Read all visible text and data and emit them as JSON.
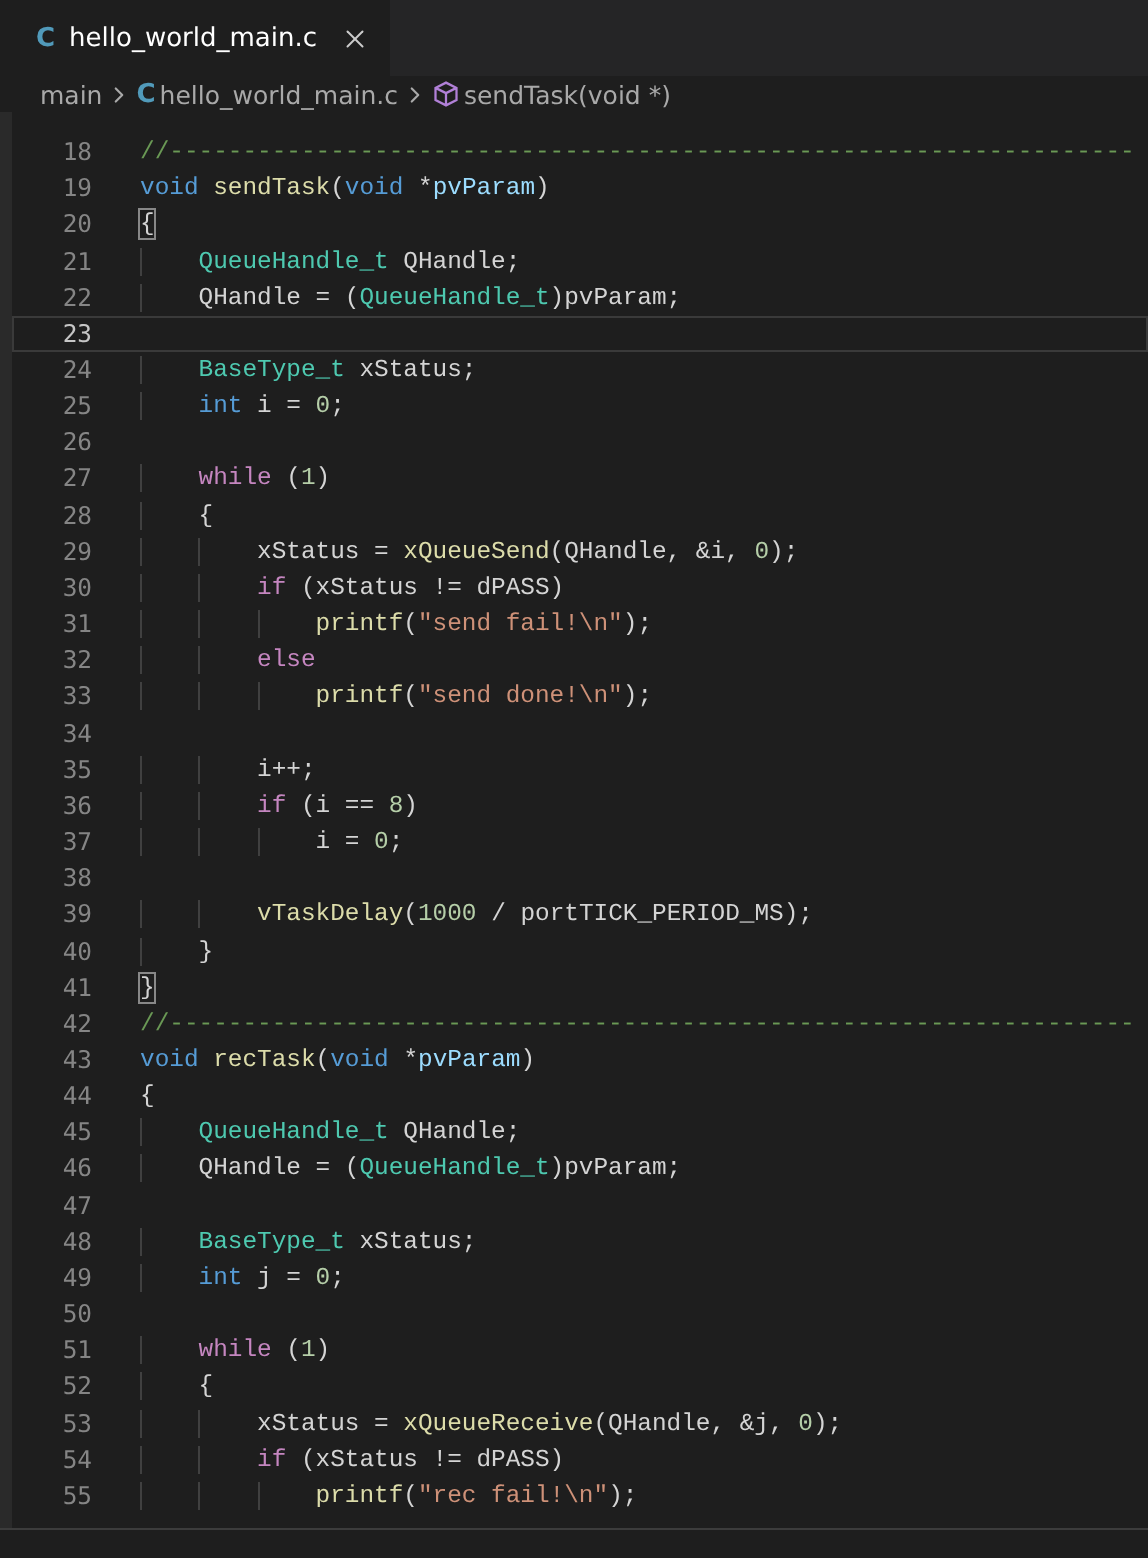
{
  "tabs": [
    {
      "label": "hello_world_main.c",
      "icon": "C",
      "selected": true
    }
  ],
  "breadcrumb": [
    {
      "kind": "folder",
      "label": "main"
    },
    {
      "kind": "file",
      "icon": "C",
      "label": "hello_world_main.c"
    },
    {
      "kind": "symbol",
      "label": "sendTask(void *)"
    }
  ],
  "lines": [
    {
      "number": "18",
      "tokens": [
        {
          "kind": "comment",
          "text": "//------------------------------------------------------------------"
        }
      ]
    },
    {
      "number": "19",
      "tokens": [
        {
          "kind": "keyword",
          "text": "void"
        },
        {
          "kind": "function",
          "text": " sendTask"
        },
        {
          "kind": "plain",
          "text": "("
        },
        {
          "kind": "keyword",
          "text": "void"
        },
        {
          "kind": "plain",
          "text": " *"
        },
        {
          "kind": "variable",
          "text": "pvParam"
        },
        {
          "kind": "plain",
          "text": ")"
        }
      ]
    },
    {
      "number": "20",
      "tokens": [
        {
          "kind": "plain",
          "text": "{",
          "matched": true
        }
      ]
    },
    {
      "number": "21",
      "tokens": [
        {
          "kind": "type",
          "text": "    QueueHandle_t"
        },
        {
          "kind": "plain",
          "text": " QHandle;"
        }
      ]
    },
    {
      "number": "22",
      "tokens": [
        {
          "kind": "plain",
          "text": "    QHandle = ("
        },
        {
          "kind": "type",
          "text": "QueueHandle_t"
        },
        {
          "kind": "plain",
          "text": ")pvParam;"
        }
      ]
    },
    {
      "number": "23",
      "current": true
    },
    {
      "number": "24",
      "tokens": [
        {
          "kind": "type",
          "text": "    BaseType_t"
        },
        {
          "kind": "plain",
          "text": " xStatus;"
        }
      ]
    },
    {
      "number": "25",
      "tokens": [
        {
          "kind": "keyword",
          "text": "    int"
        },
        {
          "kind": "plain",
          "text": " i = "
        },
        {
          "kind": "number",
          "text": "0"
        },
        {
          "kind": "plain",
          "text": ";"
        }
      ]
    },
    {
      "number": "26"
    },
    {
      "number": "27",
      "tokens": [
        {
          "kind": "control",
          "text": "    while"
        },
        {
          "kind": "plain",
          "text": " ("
        },
        {
          "kind": "number",
          "text": "1"
        },
        {
          "kind": "plain",
          "text": ")"
        }
      ]
    },
    {
      "number": "28",
      "tokens": [
        {
          "kind": "plain",
          "text": "    {"
        }
      ]
    },
    {
      "number": "29",
      "tokens": [
        {
          "kind": "plain",
          "text": "        xStatus = "
        },
        {
          "kind": "function",
          "text": "xQueueSend"
        },
        {
          "kind": "plain",
          "text": "(QHandle, &i, "
        },
        {
          "kind": "number",
          "text": "0"
        },
        {
          "kind": "plain",
          "text": ");"
        }
      ]
    },
    {
      "number": "30",
      "tokens": [
        {
          "kind": "control",
          "text": "        if"
        },
        {
          "kind": "plain",
          "text": " (xStatus != dPASS)"
        }
      ]
    },
    {
      "number": "31",
      "tokens": [
        {
          "kind": "function",
          "text": "            printf"
        },
        {
          "kind": "plain",
          "text": "("
        },
        {
          "kind": "string",
          "text": "\"send fail!\\n\""
        },
        {
          "kind": "plain",
          "text": ");"
        }
      ]
    },
    {
      "number": "32",
      "tokens": [
        {
          "kind": "control",
          "text": "        else"
        }
      ]
    },
    {
      "number": "33",
      "tokens": [
        {
          "kind": "function",
          "text": "            printf"
        },
        {
          "kind": "plain",
          "text": "("
        },
        {
          "kind": "string",
          "text": "\"send done!\\n\""
        },
        {
          "kind": "plain",
          "text": ");"
        }
      ]
    },
    {
      "number": "34"
    },
    {
      "number": "35",
      "tokens": [
        {
          "kind": "plain",
          "text": "        i++;"
        }
      ]
    },
    {
      "number": "36",
      "tokens": [
        {
          "kind": "control",
          "text": "        if"
        },
        {
          "kind": "plain",
          "text": " (i == "
        },
        {
          "kind": "number",
          "text": "8"
        },
        {
          "kind": "plain",
          "text": ")"
        }
      ]
    },
    {
      "number": "37",
      "tokens": [
        {
          "kind": "plain",
          "text": "            i = "
        },
        {
          "kind": "number",
          "text": "0"
        },
        {
          "kind": "plain",
          "text": ";"
        }
      ]
    },
    {
      "number": "38"
    },
    {
      "number": "39",
      "tokens": [
        {
          "kind": "function",
          "text": "        vTaskDelay"
        },
        {
          "kind": "plain",
          "text": "("
        },
        {
          "kind": "number",
          "text": "1000"
        },
        {
          "kind": "plain",
          "text": " / portTICK_PERIOD_MS);"
        }
      ]
    },
    {
      "number": "40",
      "tokens": [
        {
          "kind": "plain",
          "text": "    }"
        }
      ]
    },
    {
      "number": "41",
      "tokens": [
        {
          "kind": "plain",
          "text": "}",
          "matched": true
        }
      ]
    },
    {
      "number": "42",
      "tokens": [
        {
          "kind": "comment",
          "text": "//------------------------------------------------------------------"
        }
      ]
    },
    {
      "number": "43",
      "tokens": [
        {
          "kind": "keyword",
          "text": "void"
        },
        {
          "kind": "function",
          "text": " recTask"
        },
        {
          "kind": "plain",
          "text": "("
        },
        {
          "kind": "keyword",
          "text": "void"
        },
        {
          "kind": "plain",
          "text": " *"
        },
        {
          "kind": "variable",
          "text": "pvParam"
        },
        {
          "kind": "plain",
          "text": ")"
        }
      ]
    },
    {
      "number": "44",
      "tokens": [
        {
          "kind": "plain",
          "text": "{"
        }
      ]
    },
    {
      "number": "45",
      "tokens": [
        {
          "kind": "type",
          "text": "    QueueHandle_t"
        },
        {
          "kind": "plain",
          "text": " QHandle;"
        }
      ]
    },
    {
      "number": "46",
      "tokens": [
        {
          "kind": "plain",
          "text": "    QHandle = ("
        },
        {
          "kind": "type",
          "text": "QueueHandle_t"
        },
        {
          "kind": "plain",
          "text": ")pvParam;"
        }
      ]
    },
    {
      "number": "47"
    },
    {
      "number": "48",
      "tokens": [
        {
          "kind": "type",
          "text": "    BaseType_t"
        },
        {
          "kind": "plain",
          "text": " xStatus;"
        }
      ]
    },
    {
      "number": "49",
      "tokens": [
        {
          "kind": "keyword",
          "text": "    int"
        },
        {
          "kind": "plain",
          "text": " j = "
        },
        {
          "kind": "number",
          "text": "0"
        },
        {
          "kind": "plain",
          "text": ";"
        }
      ]
    },
    {
      "number": "50"
    },
    {
      "number": "51",
      "tokens": [
        {
          "kind": "control",
          "text": "    while"
        },
        {
          "kind": "plain",
          "text": " ("
        },
        {
          "kind": "number",
          "text": "1"
        },
        {
          "kind": "plain",
          "text": ")"
        }
      ]
    },
    {
      "number": "52",
      "tokens": [
        {
          "kind": "plain",
          "text": "    {"
        }
      ]
    },
    {
      "number": "53",
      "tokens": [
        {
          "kind": "plain",
          "text": "        xStatus = "
        },
        {
          "kind": "function",
          "text": "xQueueReceive"
        },
        {
          "kind": "plain",
          "text": "(QHandle, &j, "
        },
        {
          "kind": "number",
          "text": "0"
        },
        {
          "kind": "plain",
          "text": ");"
        }
      ]
    },
    {
      "number": "54",
      "tokens": [
        {
          "kind": "control",
          "text": "        if"
        },
        {
          "kind": "plain",
          "text": " (xStatus != dPASS)"
        }
      ]
    },
    {
      "number": "55",
      "tokens": [
        {
          "kind": "function",
          "text": "            printf"
        },
        {
          "kind": "plain",
          "text": "("
        },
        {
          "kind": "string",
          "text": "\"rec fail!\\n\""
        },
        {
          "kind": "plain",
          "text": ");"
        }
      ]
    }
  ]
}
